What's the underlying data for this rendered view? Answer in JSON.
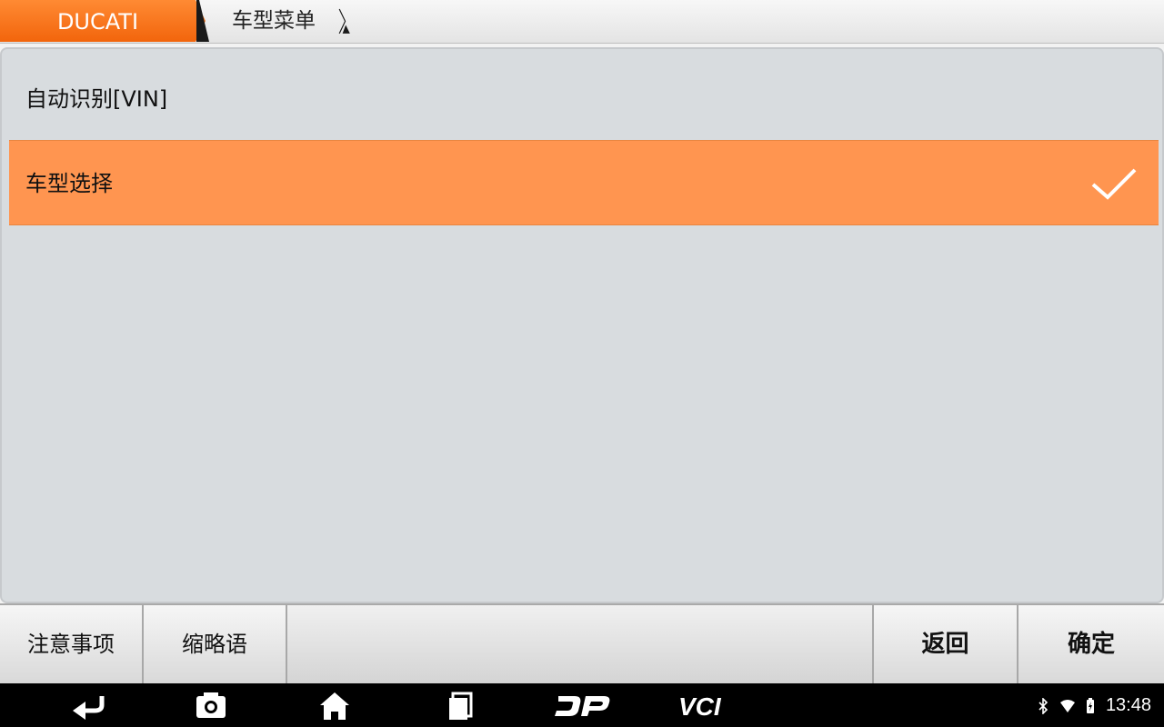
{
  "breadcrumb": {
    "home": "DUCATI",
    "current": "车型菜单"
  },
  "list": {
    "items": [
      {
        "label": "自动识别[VIN]",
        "selected": false
      },
      {
        "label": "车型选择",
        "selected": true
      }
    ],
    "selected_check_icon": "checkmark-icon"
  },
  "toolbar": {
    "notes_label": "注意事项",
    "abbreviations_label": "缩略语",
    "back_label": "返回",
    "confirm_label": "确定"
  },
  "navbar": {
    "icons": [
      "back-icon",
      "camera-icon",
      "home-icon",
      "recents-icon",
      "dp-logo-icon",
      "vci-icon"
    ],
    "vci_text": "VCI",
    "dp_text": "DP"
  },
  "status": {
    "time": "13:48",
    "icons": [
      "bluetooth-icon",
      "wifi-icon",
      "battery-icon"
    ]
  },
  "colors": {
    "accent_orange": "#f2650c",
    "selected_row": "#ff9550",
    "panel_bg": "#d8dcdf"
  }
}
